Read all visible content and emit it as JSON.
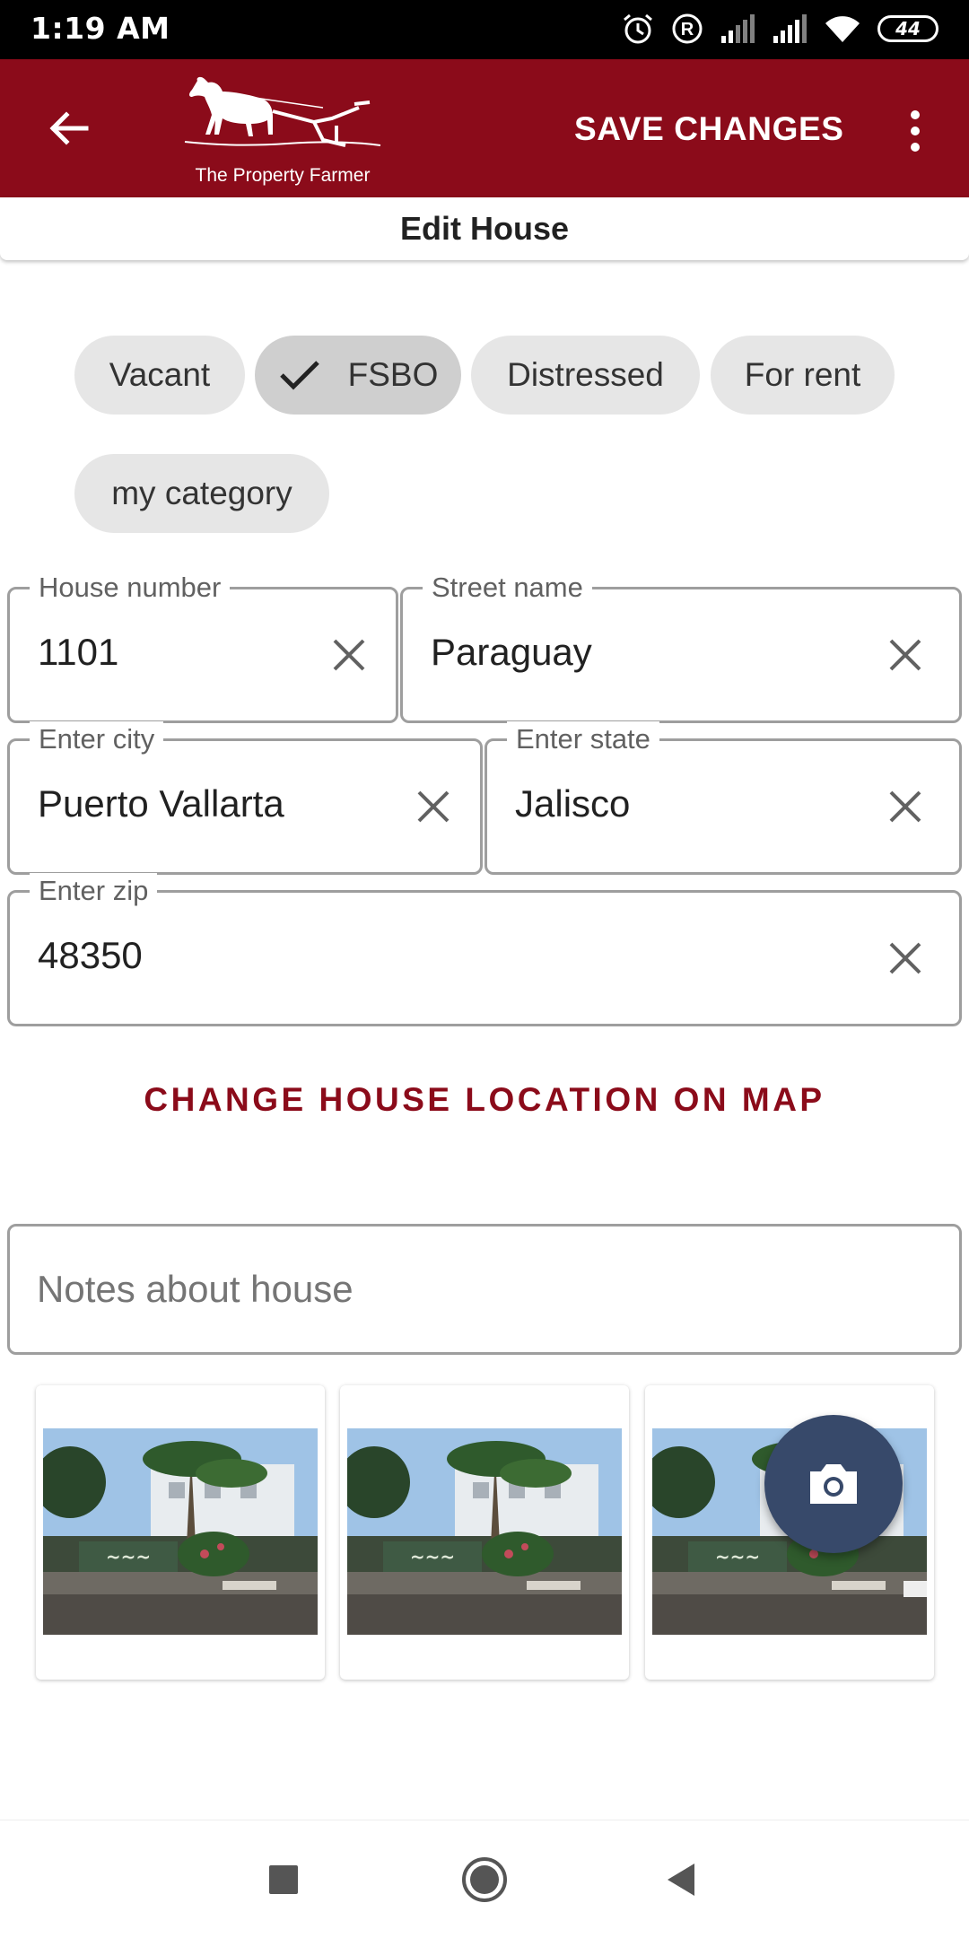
{
  "status_bar": {
    "time": "1:19 AM",
    "battery": "44",
    "icons": [
      "alarm-icon",
      "registered-icon",
      "signal-icon",
      "signal-icon",
      "wifi-icon",
      "battery-icon"
    ]
  },
  "app_bar": {
    "logo_text": "The Property Farmer",
    "save_label": "SAVE CHANGES",
    "background": "#8b0b1a"
  },
  "page_title": "Edit House",
  "categories": [
    {
      "label": "Vacant",
      "selected": false
    },
    {
      "label": "FSBO",
      "selected": true
    },
    {
      "label": "Distressed",
      "selected": false
    },
    {
      "label": "For rent",
      "selected": false
    },
    {
      "label": "my category",
      "selected": false
    }
  ],
  "fields": {
    "house_number": {
      "label": "House number",
      "value": "1101"
    },
    "street_name": {
      "label": "Street name",
      "value": "Paraguay"
    },
    "city": {
      "label": "Enter city",
      "value": "Puerto Vallarta"
    },
    "state": {
      "label": "Enter state",
      "value": "Jalisco"
    },
    "zip": {
      "label": "Enter zip",
      "value": "48350"
    }
  },
  "map_link": "CHANGE HOUSE LOCATION ON MAP",
  "notes": {
    "placeholder": "Notes about house",
    "value": ""
  },
  "photos_count": 3,
  "accent_colors": {
    "brand": "#8b0b1a",
    "fab": "#37496a"
  }
}
